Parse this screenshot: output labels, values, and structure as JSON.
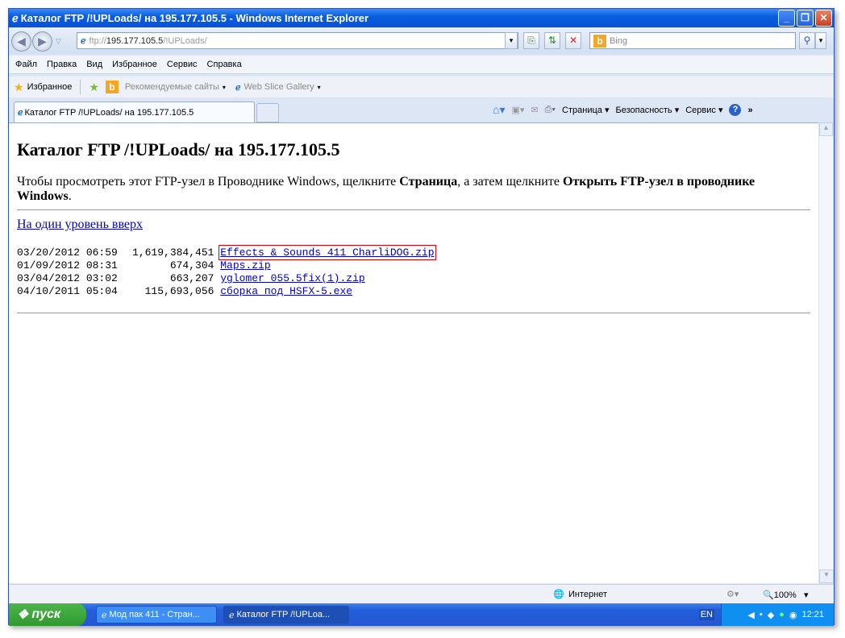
{
  "window": {
    "title": "Каталог FTP /!UPLoads/ на 195.177.105.5 - Windows Internet Explorer"
  },
  "address": {
    "prefix": "ftp://",
    "host": "195.177.105.5",
    "path": "/!UPLoads/"
  },
  "search": {
    "placeholder": "Bing"
  },
  "menu": [
    "Файл",
    "Правка",
    "Вид",
    "Избранное",
    "Сервис",
    "Справка"
  ],
  "favorites": {
    "label": "Избранное",
    "suggested": "Рекомендуемые сайты",
    "webslice": "Web Slice Gallery"
  },
  "tab": {
    "title": "Каталог FTP /!UPLoads/ на 195.177.105.5"
  },
  "commands": {
    "page": "Страница",
    "safety": "Безопасность",
    "tools": "Сервис"
  },
  "page": {
    "heading": "Каталог FTP /!UPLoads/ на 195.177.105.5",
    "intro_1": "Чтобы просмотреть этот FTP-узел в Проводнике Windows, щелкните ",
    "intro_b1": "Страница",
    "intro_2": ", а затем щелкните ",
    "intro_b2": "Открыть FTP-узел в проводнике Windows",
    "intro_3": ".",
    "up_link": "На один уровень вверх",
    "files": [
      {
        "date": "03/20/2012 06:59",
        "size": "1,619,384,451",
        "name": "Effects & Sounds_411_CharliDOG.zip"
      },
      {
        "date": "01/09/2012 08:31",
        "size": "674,304",
        "name": "Maps.zip"
      },
      {
        "date": "03/04/2012 03:02",
        "size": "663,207",
        "name": "yglomer_055.5fix(1).zip"
      },
      {
        "date": "04/10/2011 05:04",
        "size": "115,693,056",
        "name": "сборка под HSFX-5.exe"
      }
    ]
  },
  "status": {
    "zone": "Интернет",
    "zoom": "100%"
  },
  "taskbar": {
    "start": "пуск",
    "tasks": [
      "Мод пак 411 - Стран...",
      "Каталог FTP /!UPLoa..."
    ],
    "lang": "EN",
    "clock": "12:21"
  }
}
